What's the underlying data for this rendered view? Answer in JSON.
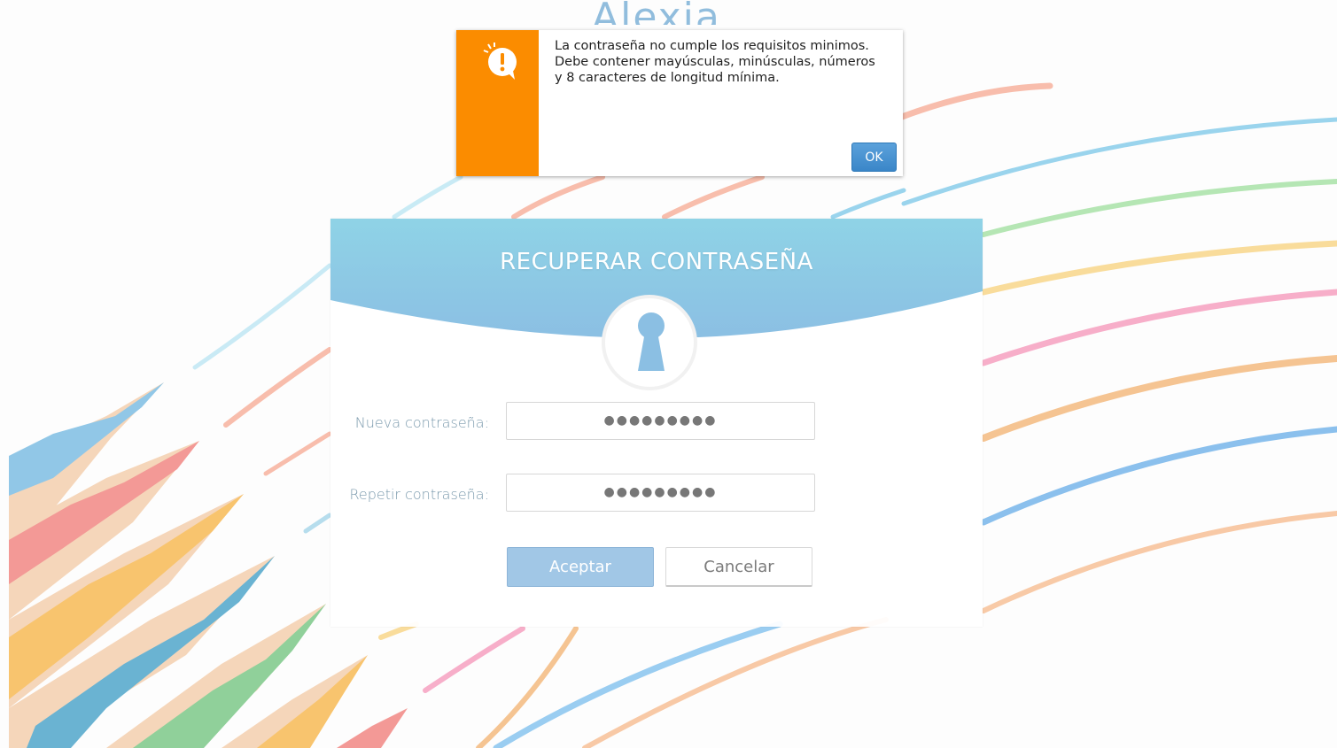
{
  "brand": {
    "logo_text": "Alexia"
  },
  "alert": {
    "lines": [
      "La contraseña no cumple los requisitos minimos.",
      "Debe contener mayúsculas, minúsculas, números",
      "y 8 caracteres de longitud mínima."
    ],
    "ok_label": "OK",
    "icon": "exclamation-speech-icon",
    "accent_color": "#fb8c00"
  },
  "card": {
    "title": "RECUPERAR CONTRASEÑA",
    "icon": "keyhole-icon",
    "new_password": {
      "label": "Nueva contraseña:",
      "value": "●●●●●●●●●"
    },
    "repeat_password": {
      "label": "Repetir contraseña:",
      "value": "●●●●●●●●●"
    },
    "accept_label": "Aceptar",
    "cancel_label": "Cancelar",
    "header_color": "#8fcbe2"
  }
}
